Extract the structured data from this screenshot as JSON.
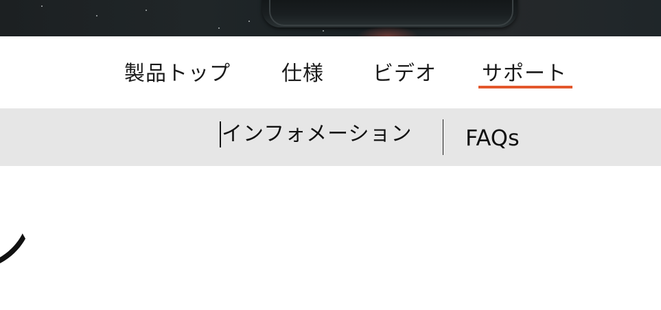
{
  "nav": {
    "items": [
      {
        "label": "製品トップ"
      },
      {
        "label": "仕様"
      },
      {
        "label": "ビデオ"
      },
      {
        "label": "サポート",
        "active": true
      }
    ],
    "active_color": "#e3582c"
  },
  "subnav": {
    "items": [
      {
        "label": "インフォメーション"
      },
      {
        "label": "FAQs"
      }
    ],
    "background": "#e6e6e6"
  },
  "content": {
    "heading_fragment": "ン"
  }
}
